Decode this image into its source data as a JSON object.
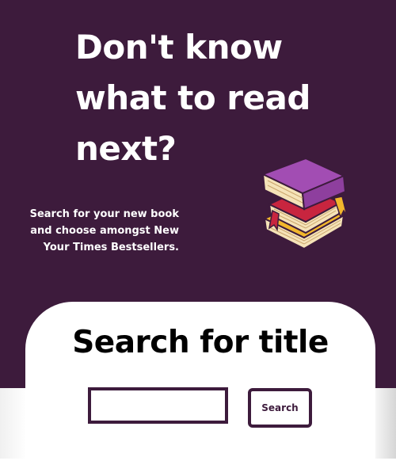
{
  "hero": {
    "headline": "Don't know what to read next?",
    "subtext": "Search for your new book and choose amongst New Your Times Bestsellers.",
    "illustration_icon": "book-stack-icon"
  },
  "search": {
    "title": "Search for title",
    "input_value": "",
    "input_placeholder": "",
    "button_label": "Search"
  },
  "colors": {
    "brand_purple": "#3d1b3c",
    "book_purple": "#8e3f9e",
    "book_red": "#c8253f",
    "book_cream": "#f5e3b8",
    "bookmark_yellow": "#f2b72c"
  }
}
